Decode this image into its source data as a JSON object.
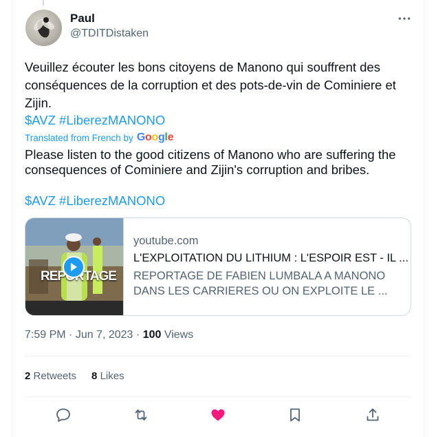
{
  "author": {
    "name": "Paul",
    "handle": "@TDITDistaken"
  },
  "tweet": {
    "text_fr": "Veuillez écouter les bons citoyens de Manono qui souffrent des conséquences de la corruption et des pots-de-vin de Cominiere et Zijin.",
    "hashtags_fr": "$AVZ #LiberezMANONO",
    "translated_label": "Translated from French by",
    "translator": "Google",
    "text_en": "Please listen to the good citizens of Manono who are suffering the consequences of Cominiere and Zijin's corruption and bribes.",
    "hashtags_en": "$AVZ #LiberezMANONO"
  },
  "card": {
    "domain": "youtube.com",
    "title": "L'EXPLOITATION DU LITHIUM : L'ESPOIR EST - IL ...",
    "description": "REPORTAGE DE FABIEN LUMBALA A MANONO DANS LES CARRIERES OU ON EXPLOITE LE ...",
    "thumb_text": "REPORTAGE"
  },
  "meta": {
    "time": "7:59 PM",
    "separator": "·",
    "date": "Jun 7, 2023",
    "views_count": "100",
    "views_label": "Views"
  },
  "stats": {
    "retweets_count": "2",
    "retweets_label": "Retweets",
    "likes_count": "8",
    "likes_label": "Likes"
  },
  "icons": {
    "reply": "reply-icon",
    "retweet": "retweet-icon",
    "like": "heart-icon",
    "bookmark": "bookmark-icon",
    "share": "share-icon",
    "more": "more-icon",
    "play": "play-icon"
  },
  "colors": {
    "link": "#1d9bf0",
    "like": "#f91880",
    "secondary": "#536471"
  }
}
